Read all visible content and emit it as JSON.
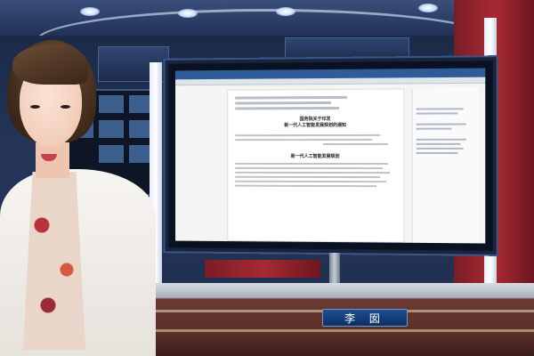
{
  "scene": {
    "type": "news-studio-broadcast",
    "palette": {
      "studio_blue": "#24345a",
      "accent_red": "#a82a33",
      "screen_blue": "#2d5c99"
    }
  },
  "monitor": {
    "site_nav": [
      "",
      "",
      "",
      "",
      "",
      "",
      "",
      ""
    ],
    "document": {
      "title_line_1": "国务院关于印发",
      "title_line_2": "新一代人工智能发展规划的通知",
      "body_heading": "新一代人工智能发展规划"
    }
  },
  "name_plate": {
    "text": "李 囡"
  }
}
